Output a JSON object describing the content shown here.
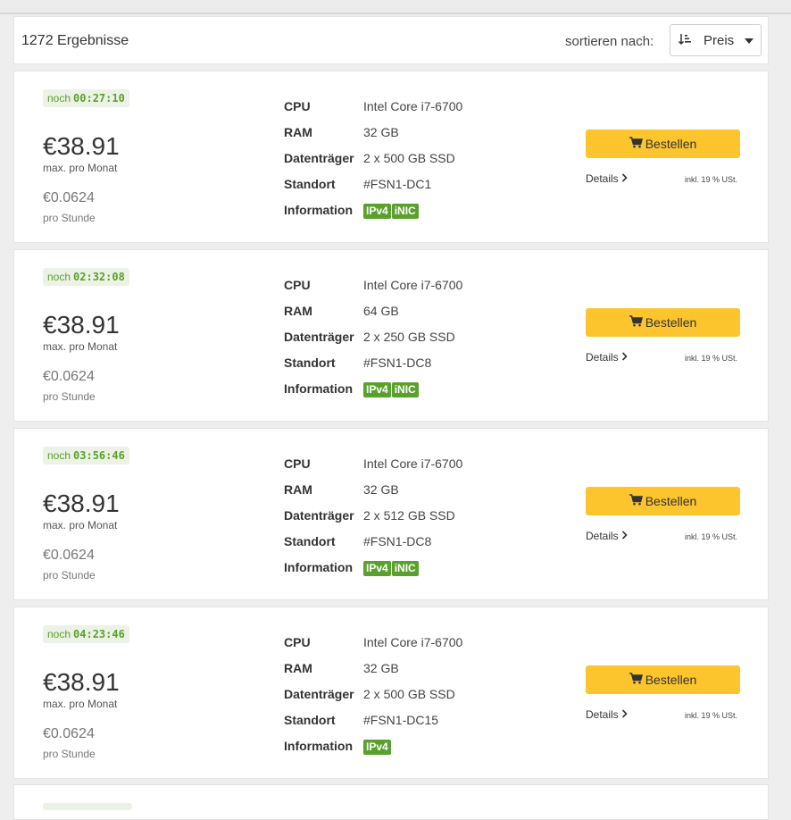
{
  "header": {
    "results_count": "1272 Ergebnisse",
    "sort_label": "sortieren nach:",
    "sort_value": "Preis"
  },
  "labels": {
    "timer_prefix": "noch",
    "price_label": "max. pro Monat",
    "hourly_label": "pro Stunde",
    "cpu": "CPU",
    "ram": "RAM",
    "storage": "Datenträger",
    "location": "Standort",
    "information": "Information",
    "order_button": "Bestellen",
    "details_link": "Details",
    "vat_note": "inkl. 19 % USt."
  },
  "servers": [
    {
      "timer": "00:27:10",
      "price": "€38.91",
      "hourly": "€0.0624",
      "cpu": "Intel Core i7-6700",
      "ram": "32 GB",
      "storage": "2 x 500 GB SSD",
      "location": "#FSN1-DC1",
      "badges": [
        "IPv4",
        "iNIC"
      ]
    },
    {
      "timer": "02:32:08",
      "price": "€38.91",
      "hourly": "€0.0624",
      "cpu": "Intel Core i7-6700",
      "ram": "64 GB",
      "storage": "2 x 250 GB SSD",
      "location": "#FSN1-DC8",
      "badges": [
        "IPv4",
        "iNIC"
      ]
    },
    {
      "timer": "03:56:46",
      "price": "€38.91",
      "hourly": "€0.0624",
      "cpu": "Intel Core i7-6700",
      "ram": "32 GB",
      "storage": "2 x 512 GB SSD",
      "location": "#FSN1-DC8",
      "badges": [
        "IPv4",
        "iNIC"
      ]
    },
    {
      "timer": "04:23:46",
      "price": "€38.91",
      "hourly": "€0.0624",
      "cpu": "Intel Core i7-6700",
      "ram": "32 GB",
      "storage": "2 x 500 GB SSD",
      "location": "#FSN1-DC15",
      "badges": [
        "IPv4"
      ]
    }
  ],
  "colors": {
    "accent_button": "#fcc52e",
    "badge_green": "#5aa02c",
    "timer_bg": "#edf2e6"
  },
  "icons": {
    "sort": "sort-amount-down-icon",
    "caret": "caret-down-icon",
    "cart": "shopping-cart-icon",
    "chevron": "chevron-right-icon"
  }
}
